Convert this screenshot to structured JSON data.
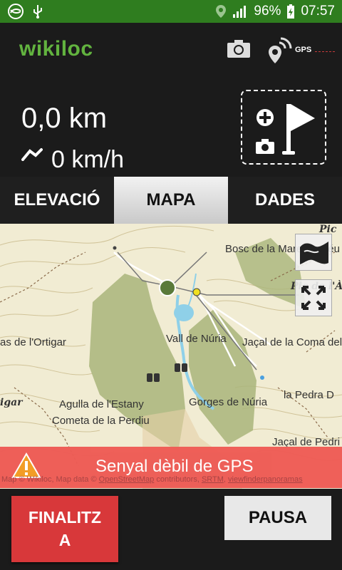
{
  "status_bar": {
    "battery_text": "96%",
    "time": "07:57",
    "icons": [
      "sync-icon",
      "usb-icon",
      "location-icon",
      "signal-icon",
      "battery-charging-icon"
    ]
  },
  "header": {
    "app_name": "wikiloc",
    "gps_label": "GPS",
    "icons": [
      "camera-icon",
      "location-broadcast-icon"
    ]
  },
  "stats": {
    "distance": "0,0 km",
    "speed": "0 km/h",
    "icons": [
      "speed-icon",
      "add-waypoint-icon"
    ]
  },
  "tabs": [
    {
      "label": "ELEVACIÓ",
      "active": false
    },
    {
      "label": "MAPA",
      "active": true
    },
    {
      "label": "DADES",
      "active": false
    }
  ],
  "map": {
    "labels": {
      "pic": "Pic",
      "bosc": "Bosc de la Mare de Déu",
      "pic_alb": "Pic de l'Àli",
      "ortigar": "as de l'Ortigar",
      "vall": "Vall de Núria",
      "jacal_coma": "Jaçal de la Coma del C",
      "igar": "igar",
      "agulla": "Agulla de l'Estany",
      "gorges": "Gorges de Núria",
      "pedra": "la Pedra D",
      "cometa": "Cometa de la Perdiu",
      "jacal_pedri": "Jaçal de Pedri"
    },
    "attribution_prefix": "Map © Wikiloc, Map data © ",
    "attribution_osm": "OpenStreetMap",
    "attribution_mid": " contributors, ",
    "attribution_srtm": "SRTM",
    "attribution_sep": ", ",
    "attribution_vf": "viewfinderpanoramas"
  },
  "gps_warning": "Senyal dèbil de GPS",
  "buttons": {
    "finish": "FINALITZ A",
    "finish_line1": "FINALITZ",
    "finish_line2": "A",
    "pause": "PAUSA"
  }
}
